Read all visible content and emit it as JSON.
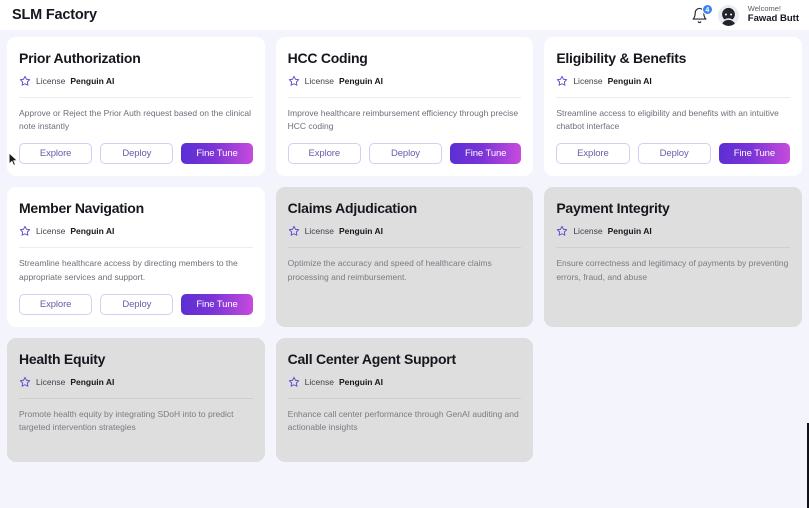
{
  "header": {
    "app_title": "SLM Factory",
    "bell_icon": "bell-icon",
    "notification_count": "4",
    "avatar_icon": "user-avatar-icon",
    "welcome_greeting": "Welcome!",
    "user_name": "Fawad Butt"
  },
  "labels": {
    "license": "License",
    "explore": "Explore",
    "deploy": "Deploy",
    "fine_tune": "Fine Tune",
    "star_icon": "star-icon"
  },
  "colors": {
    "page_background": "#f4f4fc",
    "card_background": "#ffffff",
    "card_disabled_background": "#dededf",
    "accent_purple": "#6d5aa8",
    "gradient_start": "#5b2fd4",
    "gradient_end": "#c74bdd",
    "badge_blue": "#3b82f6"
  },
  "cards": [
    {
      "title": "Prior Authorization",
      "license_label": "License",
      "license_value": "Penguin AI",
      "description": "Approve or Reject the Prior Auth request based on the clinical note instantly",
      "enabled": true
    },
    {
      "title": "HCC Coding",
      "license_label": "License",
      "license_value": "Penguin AI",
      "description": "Improve healthcare reimbursement efficiency through precise HCC coding",
      "enabled": true
    },
    {
      "title": "Eligibility & Benefits",
      "license_label": "License",
      "license_value": "Penguin AI",
      "description": "Streamline access to eligibility and benefits with an intuitive chatbot interface",
      "enabled": true
    },
    {
      "title": "Member Navigation",
      "license_label": "License",
      "license_value": "Penguin AI",
      "description": "Streamline healthcare access by directing members to the appropriate services and support.",
      "enabled": true
    },
    {
      "title": "Claims Adjudication",
      "license_label": "License",
      "license_value": "Penguin AI",
      "description": "Optimize the accuracy and speed of healthcare claims processing and reimbursement.",
      "enabled": false
    },
    {
      "title": "Payment Integrity",
      "license_label": "License",
      "license_value": "Penguin AI",
      "description": "Ensure correctness and legitimacy of payments by preventing errors, fraud, and abuse",
      "enabled": false
    },
    {
      "title": "Health Equity",
      "license_label": "License",
      "license_value": "Penguin AI",
      "description": "Promote health equity by integrating SDoH into to predict targeted intervention strategies",
      "enabled": false
    },
    {
      "title": "Call Center Agent Support",
      "license_label": "License",
      "license_value": "Penguin AI",
      "description": "Enhance call center performance through GenAI auditing and actionable insights",
      "enabled": false
    }
  ]
}
